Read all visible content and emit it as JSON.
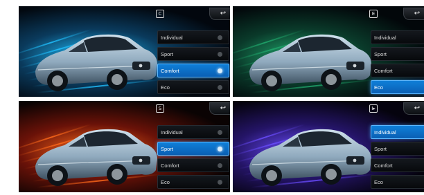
{
  "back_symbol": "↩",
  "mode_options": [
    "Individual",
    "Sport",
    "Comfort",
    "Eco"
  ],
  "panels": [
    {
      "badge": "C",
      "selected": "Comfort",
      "theme": "cyan",
      "colors": [
        "#1fc0ff",
        "#0a3a5c",
        "#02070e"
      ]
    },
    {
      "badge": "E",
      "selected": "Eco",
      "theme": "green",
      "colors": [
        "#1fa86c",
        "#0a3a2a",
        "#02070a"
      ]
    },
    {
      "badge": "S",
      "selected": "Sport",
      "theme": "red",
      "colors": [
        "#ff6a1a",
        "#6a1208",
        "#0a0303"
      ]
    },
    {
      "badge": "I▸",
      "selected": "Individual",
      "theme": "purple",
      "colors": [
        "#6a4cff",
        "#241466",
        "#05030e"
      ]
    }
  ],
  "icons": {
    "back": "back-arrow-icon",
    "car": "car-image",
    "drive_badge": "drive-mode-badge-icon",
    "radio": "radio-dot-icon"
  }
}
